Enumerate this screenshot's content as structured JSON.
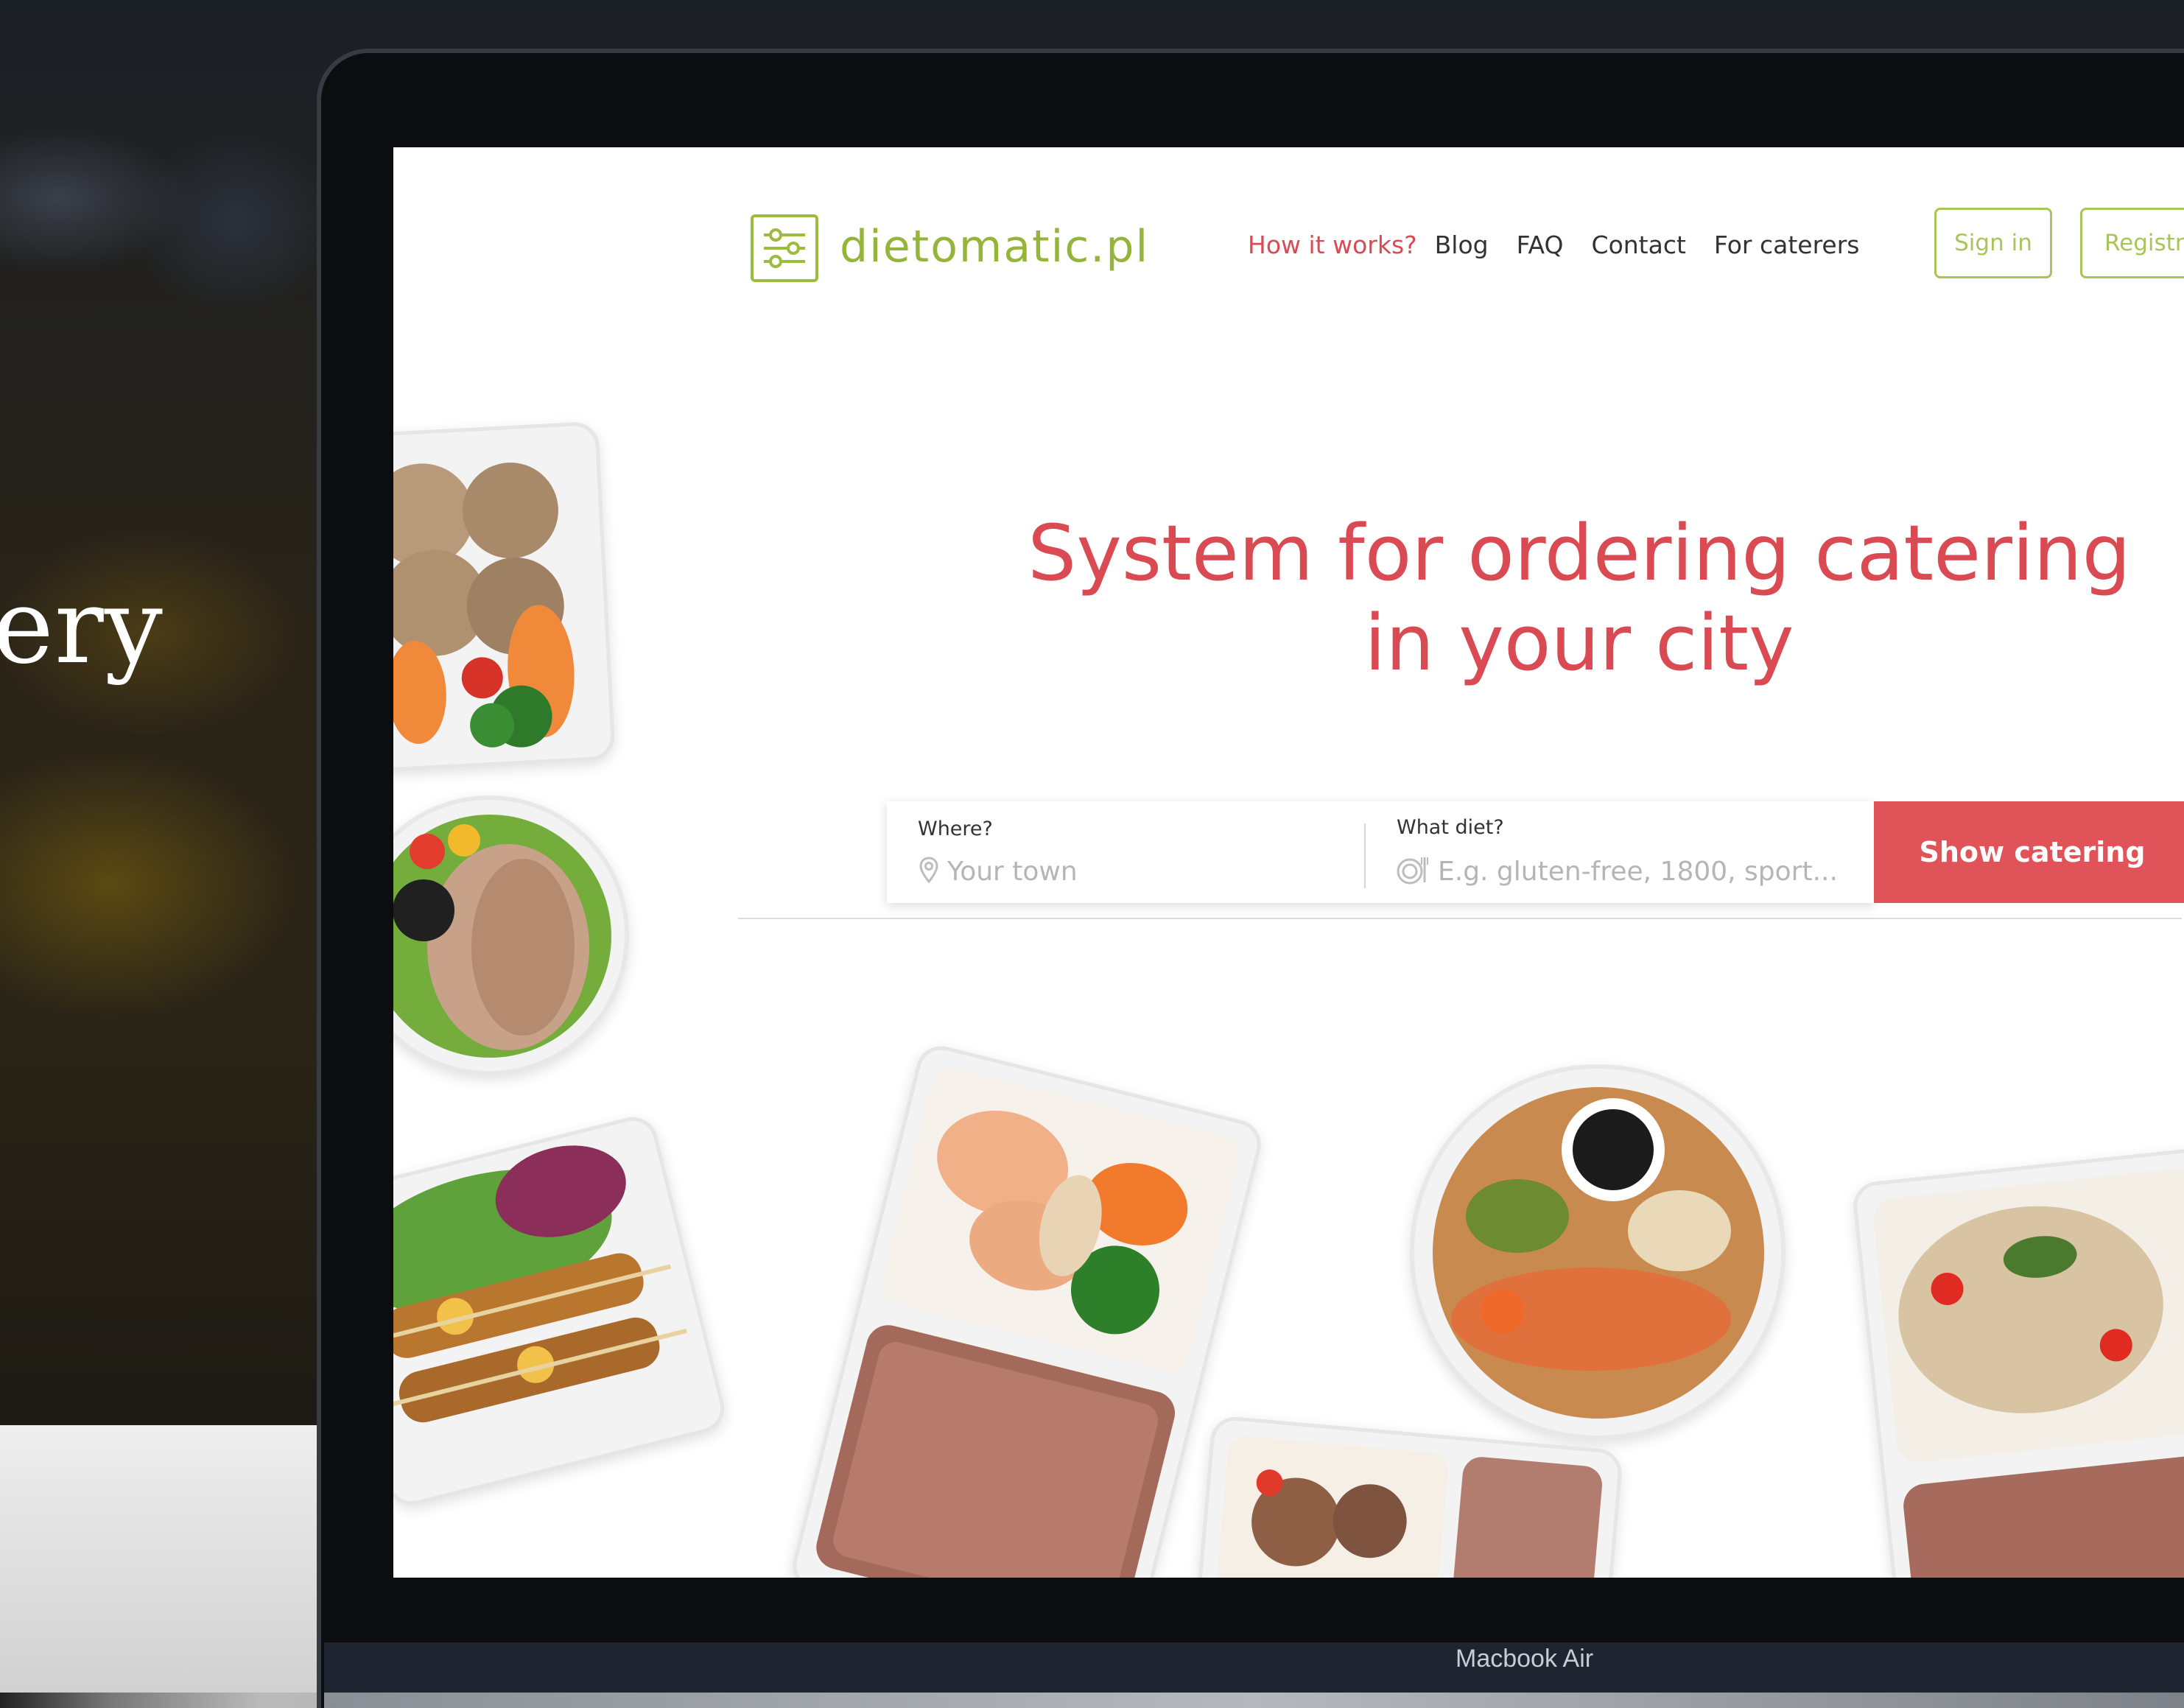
{
  "background": {
    "headline_fragment": "ery"
  },
  "device": {
    "label": "Macbook Air"
  },
  "site": {
    "logo_text": "dietomatic.pl",
    "logo_icon": "sliders-icon",
    "nav": [
      {
        "label": "How it works?",
        "active": true
      },
      {
        "label": "Blog",
        "active": false
      },
      {
        "label": "FAQ",
        "active": false
      },
      {
        "label": "Contact",
        "active": false
      },
      {
        "label": "For caterers",
        "active": false
      }
    ],
    "signin_label": "Sign in",
    "register_label": "Registra",
    "hero_title_line1": "System for ordering catering",
    "hero_title_line2": "in your city",
    "search": {
      "where_label": "Where?",
      "where_placeholder": "Your town",
      "where_icon": "map-pin-icon",
      "diet_label": "What diet?",
      "diet_placeholder": "E.g. gluten-free, 1800, sport...",
      "diet_icon": "plate-icon",
      "submit_label": "Show catering"
    },
    "colors": {
      "accent_red": "#d94a52",
      "brand_green": "#95b43a",
      "button_red": "#e05459"
    }
  }
}
